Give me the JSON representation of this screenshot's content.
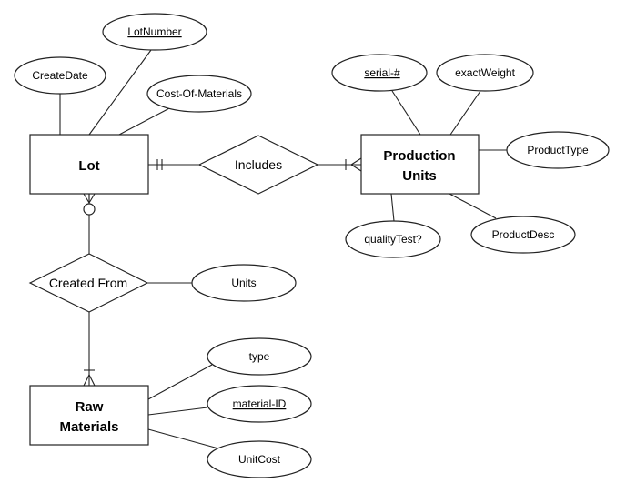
{
  "diagram": {
    "type": "ER diagram (crow's foot notation)",
    "entities": [
      {
        "id": "lot",
        "label_lines": [
          "Lot"
        ]
      },
      {
        "id": "production_units",
        "label_lines": [
          "Production",
          "Units"
        ]
      },
      {
        "id": "raw_materials",
        "label_lines": [
          "Raw",
          "Materials"
        ]
      }
    ],
    "relationships": [
      {
        "id": "includes",
        "label": "Includes",
        "from": "lot",
        "to": "production_units",
        "from_cardinality": "exactly one",
        "to_cardinality": "one or many"
      },
      {
        "id": "created_from",
        "label": "Created From",
        "from": "lot",
        "to": "raw_materials",
        "from_cardinality": "zero or many",
        "to_cardinality": "one or many"
      }
    ],
    "attributes": [
      {
        "id": "create_date",
        "label": "CreateDate",
        "owner": "lot",
        "key": false
      },
      {
        "id": "lot_number",
        "label": "LotNumber",
        "owner": "lot",
        "key": true
      },
      {
        "id": "cost_of_materials",
        "label": "Cost-Of-Materials",
        "owner": "lot",
        "key": false
      },
      {
        "id": "serial",
        "label": "serial-#",
        "owner": "production_units",
        "key": true
      },
      {
        "id": "exact_weight",
        "label": "exactWeight",
        "owner": "production_units",
        "key": false
      },
      {
        "id": "product_type",
        "label": "ProductType",
        "owner": "production_units",
        "key": false
      },
      {
        "id": "quality_test",
        "label": "qualityTest?",
        "owner": "production_units",
        "key": false
      },
      {
        "id": "product_desc",
        "label": "ProductDesc",
        "owner": "production_units",
        "key": false
      },
      {
        "id": "units",
        "label": "Units",
        "owner": "created_from",
        "key": false
      },
      {
        "id": "type",
        "label": "type",
        "owner": "raw_materials",
        "key": false
      },
      {
        "id": "material_id",
        "label": "material-ID",
        "owner": "raw_materials",
        "key": true
      },
      {
        "id": "unit_cost",
        "label": "UnitCost",
        "owner": "raw_materials",
        "key": false
      }
    ]
  }
}
